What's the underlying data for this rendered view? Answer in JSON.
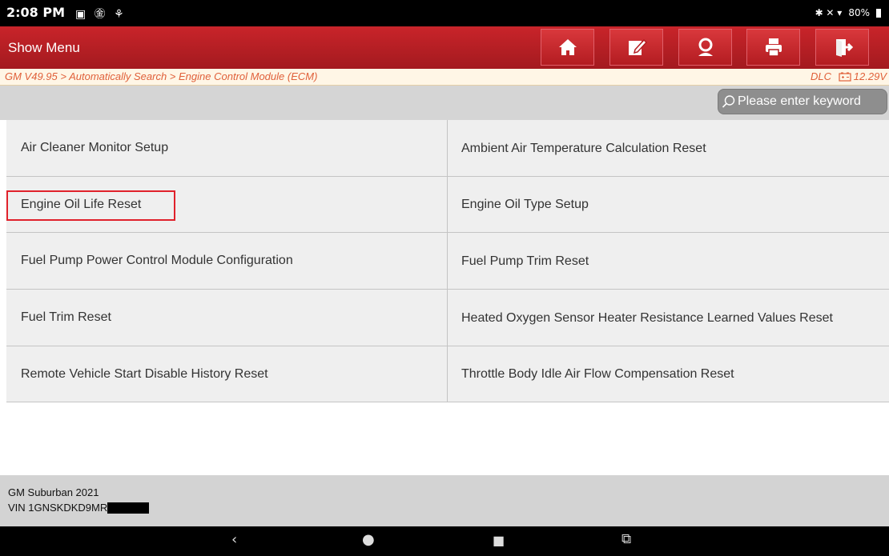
{
  "status_bar": {
    "time": "2:08 PM",
    "left_icons": "▣ ㊎ ⚘",
    "right_icons": "✱ ✕ ▾",
    "battery": "80%"
  },
  "topbar": {
    "title": "Show Menu",
    "buttons": [
      "home-icon",
      "edit-icon",
      "user-icon",
      "print-icon",
      "exit-icon"
    ]
  },
  "breadcrumb": {
    "path": "GM V49.95 > Automatically Search > Engine Control Module (ECM)",
    "dlc": "DLC",
    "voltage": "12.29V"
  },
  "search": {
    "placeholder": "Please enter keyword"
  },
  "menu": {
    "rows": [
      {
        "left": "Air Cleaner Monitor Setup",
        "right": "Ambient Air Temperature Calculation Reset"
      },
      {
        "left": "Engine Oil Life Reset",
        "right": "Engine Oil Type Setup"
      },
      {
        "left": "Fuel Pump Power Control Module Configuration",
        "right": "Fuel Pump Trim Reset"
      },
      {
        "left": "Fuel Trim Reset",
        "right": "Heated Oxygen Sensor Heater Resistance Learned Values Reset"
      },
      {
        "left": "Remote Vehicle Start Disable History Reset",
        "right": "Throttle Body Idle Air Flow Compensation Reset"
      }
    ],
    "highlighted": "Engine Oil Life Reset"
  },
  "footer": {
    "model": "GM Suburban 2021",
    "vin": "VIN 1GNSKDKD9MR"
  },
  "navbar": {
    "back": "‹",
    "home": "●",
    "recents": "■",
    "screenshot": "⧉"
  },
  "colors": {
    "accent": "#c9242a",
    "highlight": "#e0212b",
    "breadcrumb_text": "#e0603a"
  }
}
